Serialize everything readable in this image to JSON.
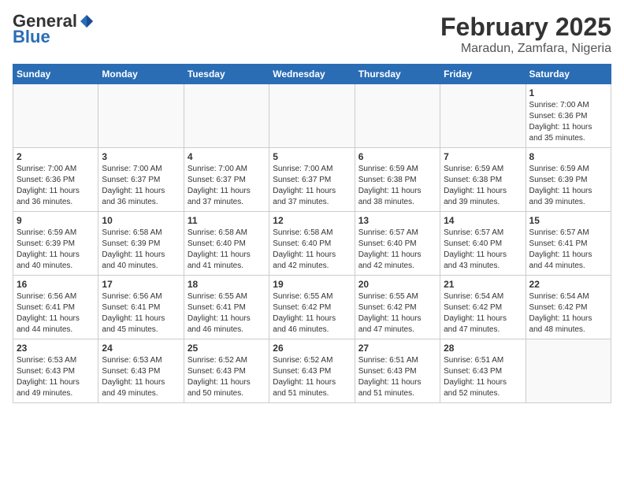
{
  "header": {
    "logo_general": "General",
    "logo_blue": "Blue",
    "month_title": "February 2025",
    "location": "Maradun, Zamfara, Nigeria"
  },
  "days_of_week": [
    "Sunday",
    "Monday",
    "Tuesday",
    "Wednesday",
    "Thursday",
    "Friday",
    "Saturday"
  ],
  "weeks": [
    [
      {
        "day": "",
        "info": ""
      },
      {
        "day": "",
        "info": ""
      },
      {
        "day": "",
        "info": ""
      },
      {
        "day": "",
        "info": ""
      },
      {
        "day": "",
        "info": ""
      },
      {
        "day": "",
        "info": ""
      },
      {
        "day": "1",
        "info": "Sunrise: 7:00 AM\nSunset: 6:36 PM\nDaylight: 11 hours\nand 35 minutes."
      }
    ],
    [
      {
        "day": "2",
        "info": "Sunrise: 7:00 AM\nSunset: 6:36 PM\nDaylight: 11 hours\nand 36 minutes."
      },
      {
        "day": "3",
        "info": "Sunrise: 7:00 AM\nSunset: 6:37 PM\nDaylight: 11 hours\nand 36 minutes."
      },
      {
        "day": "4",
        "info": "Sunrise: 7:00 AM\nSunset: 6:37 PM\nDaylight: 11 hours\nand 37 minutes."
      },
      {
        "day": "5",
        "info": "Sunrise: 7:00 AM\nSunset: 6:37 PM\nDaylight: 11 hours\nand 37 minutes."
      },
      {
        "day": "6",
        "info": "Sunrise: 6:59 AM\nSunset: 6:38 PM\nDaylight: 11 hours\nand 38 minutes."
      },
      {
        "day": "7",
        "info": "Sunrise: 6:59 AM\nSunset: 6:38 PM\nDaylight: 11 hours\nand 39 minutes."
      },
      {
        "day": "8",
        "info": "Sunrise: 6:59 AM\nSunset: 6:39 PM\nDaylight: 11 hours\nand 39 minutes."
      }
    ],
    [
      {
        "day": "9",
        "info": "Sunrise: 6:59 AM\nSunset: 6:39 PM\nDaylight: 11 hours\nand 40 minutes."
      },
      {
        "day": "10",
        "info": "Sunrise: 6:58 AM\nSunset: 6:39 PM\nDaylight: 11 hours\nand 40 minutes."
      },
      {
        "day": "11",
        "info": "Sunrise: 6:58 AM\nSunset: 6:40 PM\nDaylight: 11 hours\nand 41 minutes."
      },
      {
        "day": "12",
        "info": "Sunrise: 6:58 AM\nSunset: 6:40 PM\nDaylight: 11 hours\nand 42 minutes."
      },
      {
        "day": "13",
        "info": "Sunrise: 6:57 AM\nSunset: 6:40 PM\nDaylight: 11 hours\nand 42 minutes."
      },
      {
        "day": "14",
        "info": "Sunrise: 6:57 AM\nSunset: 6:40 PM\nDaylight: 11 hours\nand 43 minutes."
      },
      {
        "day": "15",
        "info": "Sunrise: 6:57 AM\nSunset: 6:41 PM\nDaylight: 11 hours\nand 44 minutes."
      }
    ],
    [
      {
        "day": "16",
        "info": "Sunrise: 6:56 AM\nSunset: 6:41 PM\nDaylight: 11 hours\nand 44 minutes."
      },
      {
        "day": "17",
        "info": "Sunrise: 6:56 AM\nSunset: 6:41 PM\nDaylight: 11 hours\nand 45 minutes."
      },
      {
        "day": "18",
        "info": "Sunrise: 6:55 AM\nSunset: 6:41 PM\nDaylight: 11 hours\nand 46 minutes."
      },
      {
        "day": "19",
        "info": "Sunrise: 6:55 AM\nSunset: 6:42 PM\nDaylight: 11 hours\nand 46 minutes."
      },
      {
        "day": "20",
        "info": "Sunrise: 6:55 AM\nSunset: 6:42 PM\nDaylight: 11 hours\nand 47 minutes."
      },
      {
        "day": "21",
        "info": "Sunrise: 6:54 AM\nSunset: 6:42 PM\nDaylight: 11 hours\nand 47 minutes."
      },
      {
        "day": "22",
        "info": "Sunrise: 6:54 AM\nSunset: 6:42 PM\nDaylight: 11 hours\nand 48 minutes."
      }
    ],
    [
      {
        "day": "23",
        "info": "Sunrise: 6:53 AM\nSunset: 6:43 PM\nDaylight: 11 hours\nand 49 minutes."
      },
      {
        "day": "24",
        "info": "Sunrise: 6:53 AM\nSunset: 6:43 PM\nDaylight: 11 hours\nand 49 minutes."
      },
      {
        "day": "25",
        "info": "Sunrise: 6:52 AM\nSunset: 6:43 PM\nDaylight: 11 hours\nand 50 minutes."
      },
      {
        "day": "26",
        "info": "Sunrise: 6:52 AM\nSunset: 6:43 PM\nDaylight: 11 hours\nand 51 minutes."
      },
      {
        "day": "27",
        "info": "Sunrise: 6:51 AM\nSunset: 6:43 PM\nDaylight: 11 hours\nand 51 minutes."
      },
      {
        "day": "28",
        "info": "Sunrise: 6:51 AM\nSunset: 6:43 PM\nDaylight: 11 hours\nand 52 minutes."
      },
      {
        "day": "",
        "info": ""
      }
    ]
  ]
}
